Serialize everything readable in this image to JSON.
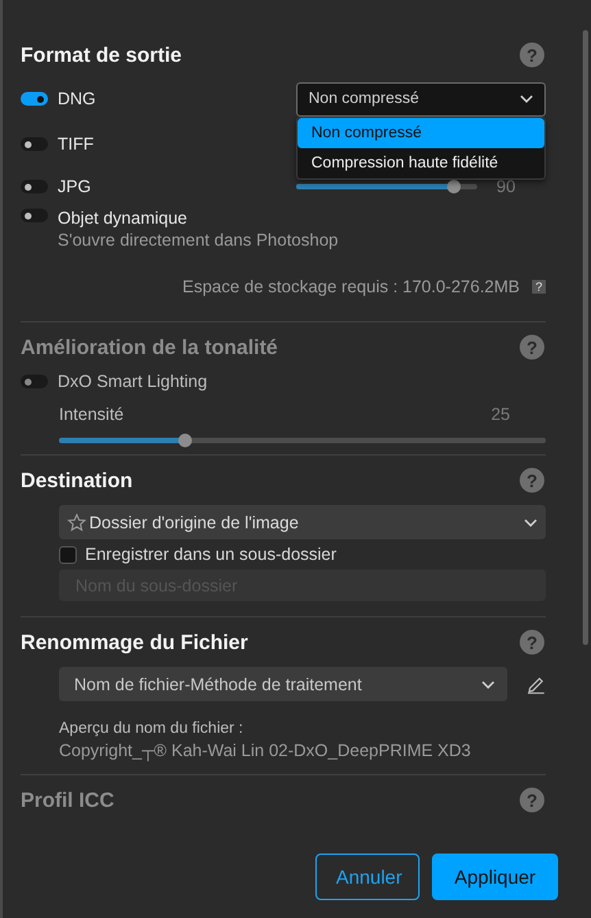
{
  "sections": [
    {
      "kind": "format",
      "title": "Format de sortie",
      "disabled": false,
      "help": "?",
      "formats": [
        {
          "kind": "select",
          "label": "DNG",
          "on": true,
          "select": {
            "value": "Non compressé",
            "expanded": true,
            "options": [
              {
                "label": "Non compressé",
                "selected": true
              },
              {
                "label": "Compression haute fidélité",
                "selected": false
              }
            ]
          }
        },
        {
          "kind": "plain",
          "label": "TIFF",
          "on": false
        },
        {
          "kind": "slider",
          "label": "JPG",
          "on": false,
          "level": 0.87,
          "reading": "90"
        },
        {
          "kind": "plain",
          "label": "Objet dynamique",
          "on": false,
          "note": "S'ouvre directement dans Photoshop"
        }
      ],
      "storage": "Espace de stockage requis : 170.0-276.2MB",
      "storage_help": "?"
    },
    {
      "kind": "tone",
      "title": "Amélioration de la tonalité",
      "disabled": true,
      "help": "?",
      "toggle": {
        "label": "DxO Smart Lighting",
        "on": false,
        "disabled": true
      },
      "slider": {
        "label": "Intensité",
        "reading": "25",
        "level": 0.26
      }
    },
    {
      "kind": "destination",
      "title": "Destination",
      "disabled": false,
      "help": "?",
      "folder": "Dossier d'origine de l'image",
      "subfolder": {
        "label": "Enregistrer dans un sous-dossier",
        "checked": false
      },
      "subfolder_name": {
        "placeholder": "Nom du sous-dossier"
      }
    },
    {
      "kind": "rename",
      "title": "Renommage du Fichier",
      "disabled": false,
      "help": "?",
      "pattern": "Nom de fichier-Méthode de traitement",
      "preview_label": "Aperçu du nom du fichier :",
      "preview": "Copyright_┬® Kah-Wai Lin 02-DxO_DeepPRIME XD3"
    },
    {
      "kind": "icc",
      "title": "Profil ICC",
      "disabled": true,
      "help": "?"
    }
  ],
  "buttons": [
    {
      "label": "Annuler",
      "kind": "secondary"
    },
    {
      "label": "Appliquer",
      "kind": "primary"
    }
  ]
}
